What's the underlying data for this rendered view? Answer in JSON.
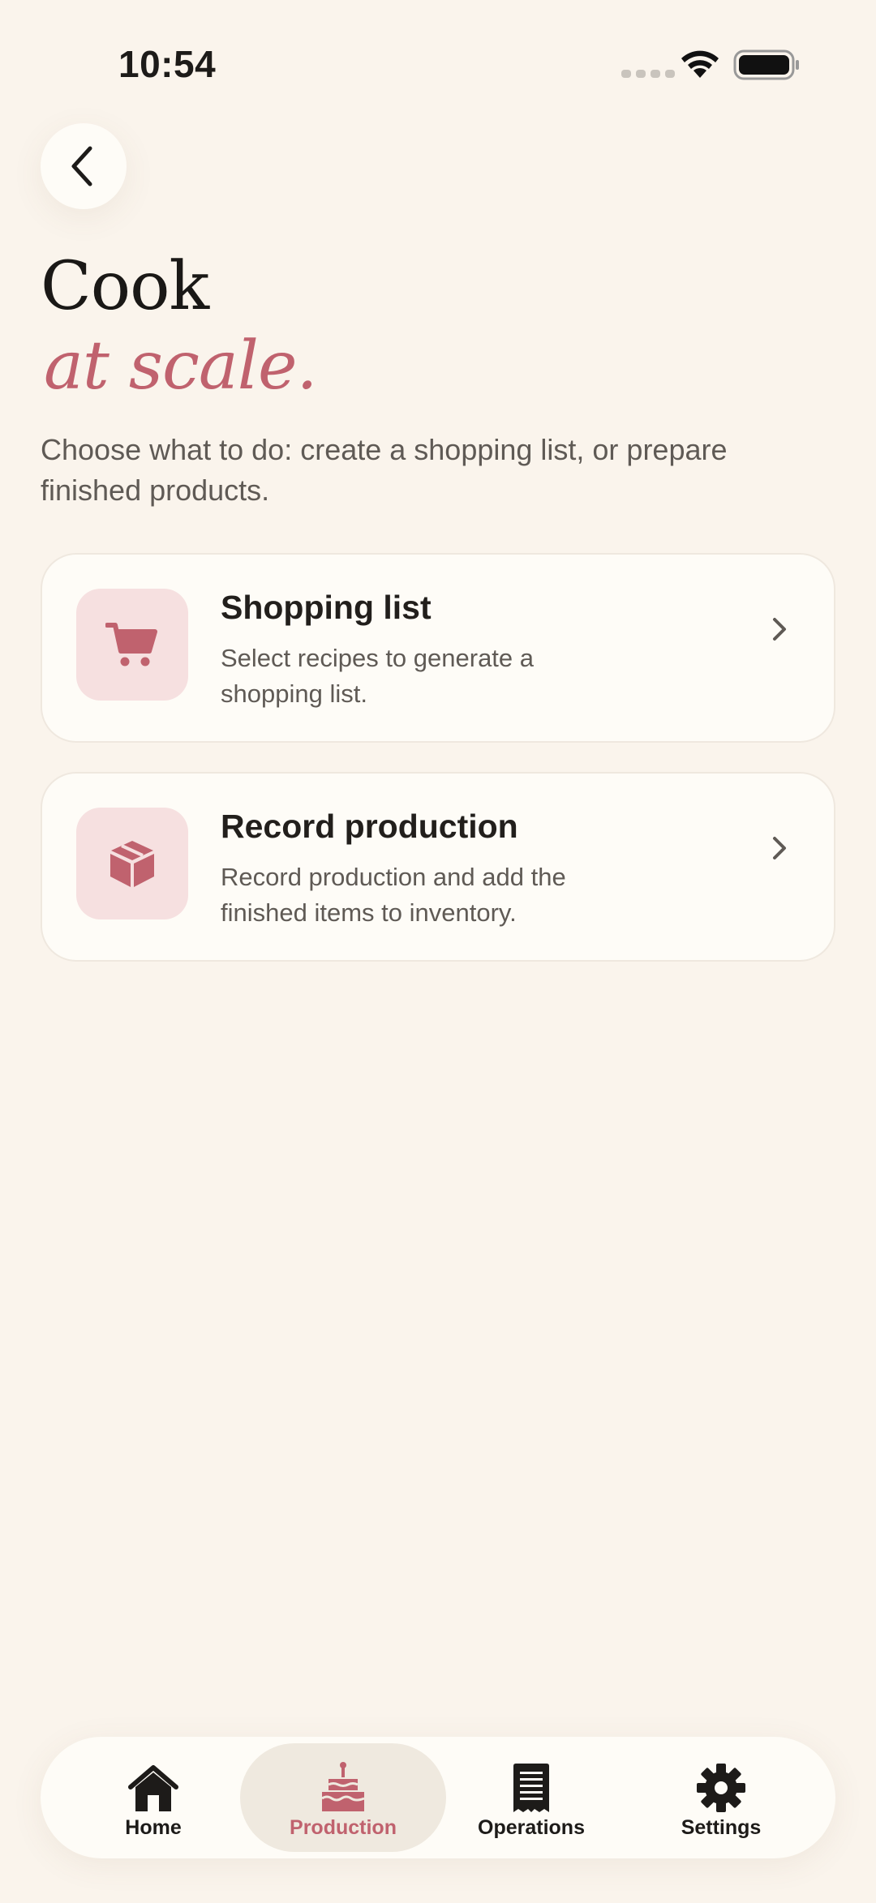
{
  "status_bar": {
    "time": "10:54",
    "icons": [
      "signal-icon",
      "wifi-icon",
      "battery-icon"
    ]
  },
  "header": {
    "back_icon": "chevron-left-icon",
    "title": "Cook",
    "title_accent": "at scale.",
    "subtitle": "Choose what to do: create a shopping list, or prepare finished products."
  },
  "actions": [
    {
      "icon": "cart-icon",
      "title": "Shopping list",
      "description": "Select recipes to generate a shopping list."
    },
    {
      "icon": "box-icon",
      "title": "Record production",
      "description": "Record production and add the finished items to inventory."
    }
  ],
  "tabbar": {
    "active": "Production",
    "tabs": [
      {
        "label": "Home",
        "icon": "home-icon"
      },
      {
        "label": "Production",
        "icon": "cake-icon"
      },
      {
        "label": "Operations",
        "icon": "receipt-icon"
      },
      {
        "label": "Settings",
        "icon": "gear-icon"
      }
    ]
  },
  "colors": {
    "background": "#faf4ec",
    "card": "#fefcf7",
    "accent": "#c0626e",
    "icon_tile": "#f6e0e0",
    "active_tab": "#efe9df"
  }
}
